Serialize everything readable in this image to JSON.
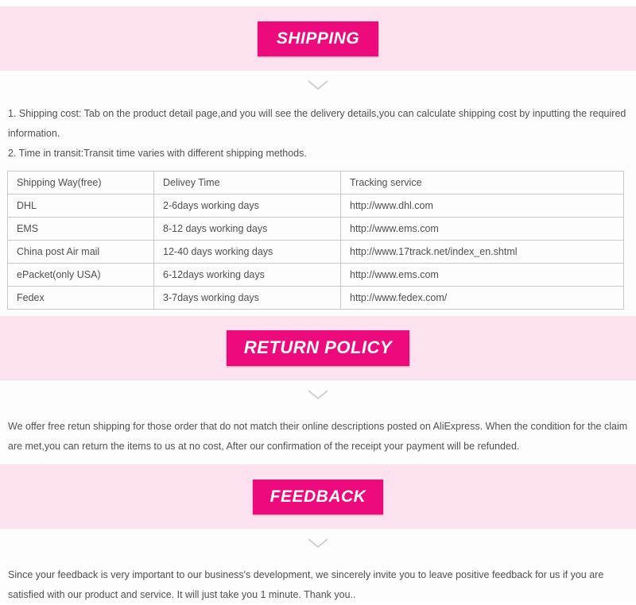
{
  "sections": {
    "shipping": {
      "badge_label": "SHIPPING",
      "line1": "1. Shipping cost: Tab on the product detail page,and you will see the delivery details,you can calculate shipping cost by inputting the required information.",
      "line2": "2. Time in transit:Transit time varies with different shipping methods.",
      "table": {
        "headers": [
          "Shipping Way(free)",
          "Delivey Time",
          "Tracking service"
        ],
        "rows": [
          [
            "DHL",
            "2-6days working days",
            "http://www.dhl.com"
          ],
          [
            "EMS",
            "8-12 days working days",
            "http://www.ems.com"
          ],
          [
            "China post Air mail",
            "12-40 days working days",
            "http://www.17track.net/index_en.shtml"
          ],
          [
            "ePacket(only USA)",
            "6-12days working days",
            "http://www.ems.com"
          ],
          [
            "Fedex",
            "3-7days working days",
            "http://www.fedex.com/"
          ]
        ]
      }
    },
    "return_policy": {
      "badge_label": "RETURN POLICY",
      "body": "We offer free retun shipping for those order that do not match their online descriptions posted on AliExpress. When the condition for the claim are met,you can return the items to us at no cost, After our confirmation of the receipt your payment will be refunded."
    },
    "feedback": {
      "badge_label": "FEEDBACK",
      "body": "Since your feedback is very important to our business's development, we sincerely invite you to leave positive feedback for us if you are satisfied with our product and service. It will just take you 1 minute. Thank you.."
    }
  },
  "icons": {
    "chevron_down": "chevron-down-icon"
  },
  "colors": {
    "badge_pink": "#ec0a7c",
    "band_pink": "#fce1ee",
    "text_gray": "#4f4f4f",
    "table_border": "#c9c9c9"
  }
}
